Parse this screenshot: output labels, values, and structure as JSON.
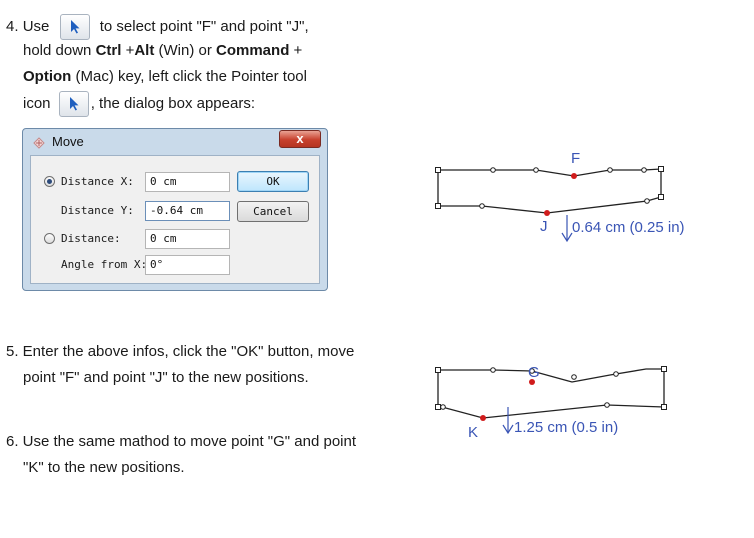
{
  "step4": {
    "number": "4.",
    "l1a": "Use",
    "l1b": "to select point \"F\" and point \"J\",",
    "l2a": "hold down",
    "l2b": "Ctrl",
    "l2c": "+",
    "l2d": "Alt",
    "l2e": "(Win) or",
    "l2f": "Command",
    "l2g": "+",
    "l3a": "Option",
    "l3b": "(Mac) key, left click the Pointer tool",
    "l4a": "icon",
    "l4b": ", the dialog box appears:"
  },
  "dialog": {
    "title": "Move",
    "close_label": "x",
    "distance_x_label": "Distance X:",
    "distance_x_value": "0 cm",
    "distance_y_label": "Distance Y:",
    "distance_y_value": "-0.64 cm",
    "distance_label": "Distance:",
    "distance_value": "0 cm",
    "angle_label": "Angle from X:",
    "angle_value": "0°",
    "ok_label": "OK",
    "cancel_label": "Cancel"
  },
  "step5": {
    "line1": "5. Enter the above infos, click the \"OK\" button, move",
    "line2": "point \"F\" and point \"J\" to the new positions."
  },
  "step6": {
    "line1": "6. Use the same mathod to move point \"G\" and point",
    "line2": "\"K\" to the new positions."
  },
  "figure1": {
    "point_top": "F",
    "point_bottom": "J",
    "offset": "0.64 cm (0.25 in)"
  },
  "figure2": {
    "point_top": "G",
    "point_bottom": "K",
    "offset": "1.25 cm (0.5 in)"
  },
  "colors": {
    "annotation": "#3a55b5",
    "selected_point": "#d01c1c",
    "dialog_frame": "#c9daea"
  }
}
